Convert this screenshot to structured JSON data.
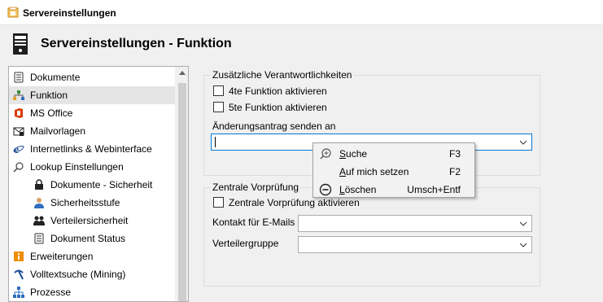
{
  "window": {
    "title": "Servereinstellungen"
  },
  "header": {
    "title": "Servereinstellungen - Funktion"
  },
  "sidebar": {
    "items": [
      {
        "label": "Dokumente",
        "icon": "document-list-icon",
        "selected": false
      },
      {
        "label": "Funktion",
        "icon": "org-chart-icon",
        "selected": true
      },
      {
        "label": "MS Office",
        "icon": "office-icon",
        "selected": false
      },
      {
        "label": "Mailvorlagen",
        "icon": "mail-template-icon",
        "selected": false
      },
      {
        "label": "Internetlinks & Webinterface",
        "icon": "internet-explorer-icon",
        "selected": false
      },
      {
        "label": "Lookup Einstellungen",
        "icon": "magnifier-icon",
        "selected": false
      },
      {
        "label": "Dokumente - Sicherheit",
        "icon": "lock-icon",
        "selected": false
      },
      {
        "label": "Sicherheitsstufe",
        "icon": "user-icon",
        "selected": false
      },
      {
        "label": "Verteilersicherheit",
        "icon": "users-icon",
        "selected": false
      },
      {
        "label": "Dokument Status",
        "icon": "document-status-icon",
        "selected": false
      },
      {
        "label": "Erweiterungen",
        "icon": "extensions-icon",
        "selected": false
      },
      {
        "label": "Volltextsuche (Mining)",
        "icon": "pickaxe-icon",
        "selected": false
      },
      {
        "label": "Prozesse",
        "icon": "process-icon",
        "selected": false
      }
    ]
  },
  "group_responsibilities": {
    "title": "Zusätzliche Verantwortlichkeiten",
    "checkbox_4te": "4te Funktion aktivieren",
    "checkbox_5te": "5te Funktion aktivieren",
    "change_request_label": "Änderungsantrag senden an",
    "change_request_value": ""
  },
  "group_precheck": {
    "title": "Zentrale Vorprüfung",
    "checkbox_label": "Zentrale Vorprüfung aktivieren",
    "contact_label": "Kontakt für E-Mails",
    "contact_value": "",
    "distribution_label": "Verteilergruppe",
    "distribution_value": ""
  },
  "context_menu": {
    "items": [
      {
        "label_u": "S",
        "label_rest": "uche",
        "shortcut": "F3",
        "icon": "search-add-icon"
      },
      {
        "label_u": "A",
        "label_rest": "uf mich setzen",
        "shortcut": "F2",
        "icon": ""
      },
      {
        "label_u": "L",
        "label_rest": "öschen",
        "shortcut": "Umsch+Entf",
        "icon": "delete-circle-icon"
      }
    ]
  },
  "colors": {
    "focus_border": "#0078d7",
    "selection": "#e5e5e5",
    "window_bg": "#f0f0f0"
  }
}
